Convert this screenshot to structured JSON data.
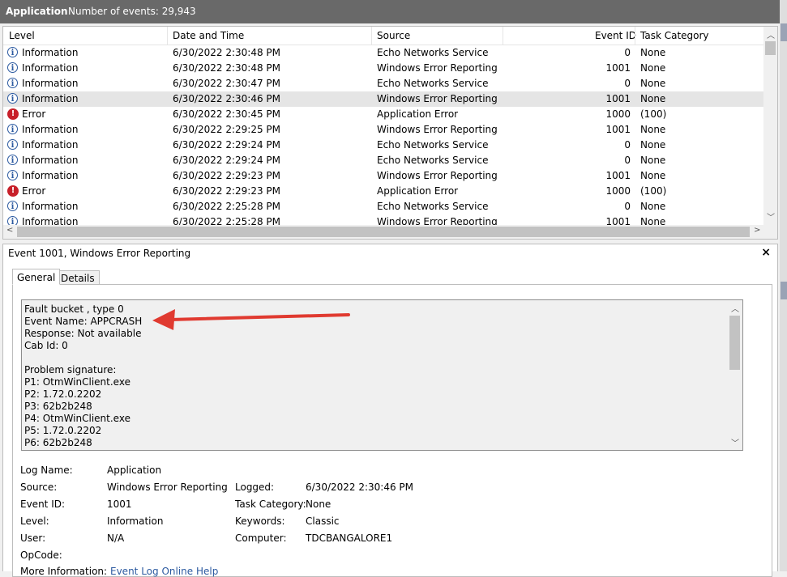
{
  "header": {
    "app": "Application",
    "count": "Number of events: 29,943"
  },
  "columns": {
    "level": "Level",
    "date": "Date and Time",
    "source": "Source",
    "event_id": "Event ID",
    "task": "Task Category"
  },
  "events": [
    {
      "level": "Information",
      "date": "6/30/2022 2:30:48 PM",
      "source": "Echo Networks Service",
      "id": "0",
      "task": "None",
      "type": "info"
    },
    {
      "level": "Information",
      "date": "6/30/2022 2:30:48 PM",
      "source": "Windows Error Reporting",
      "id": "1001",
      "task": "None",
      "type": "info"
    },
    {
      "level": "Information",
      "date": "6/30/2022 2:30:47 PM",
      "source": "Echo Networks Service",
      "id": "0",
      "task": "None",
      "type": "info"
    },
    {
      "level": "Information",
      "date": "6/30/2022 2:30:46 PM",
      "source": "Windows Error Reporting",
      "id": "1001",
      "task": "None",
      "type": "info",
      "selected": true
    },
    {
      "level": "Error",
      "date": "6/30/2022 2:30:45 PM",
      "source": "Application Error",
      "id": "1000",
      "task": "(100)",
      "type": "error"
    },
    {
      "level": "Information",
      "date": "6/30/2022 2:29:25 PM",
      "source": "Windows Error Reporting",
      "id": "1001",
      "task": "None",
      "type": "info"
    },
    {
      "level": "Information",
      "date": "6/30/2022 2:29:24 PM",
      "source": "Echo Networks Service",
      "id": "0",
      "task": "None",
      "type": "info"
    },
    {
      "level": "Information",
      "date": "6/30/2022 2:29:24 PM",
      "source": "Echo Networks Service",
      "id": "0",
      "task": "None",
      "type": "info"
    },
    {
      "level": "Information",
      "date": "6/30/2022 2:29:23 PM",
      "source": "Windows Error Reporting",
      "id": "1001",
      "task": "None",
      "type": "info"
    },
    {
      "level": "Error",
      "date": "6/30/2022 2:29:23 PM",
      "source": "Application Error",
      "id": "1000",
      "task": "(100)",
      "type": "error"
    },
    {
      "level": "Information",
      "date": "6/30/2022 2:25:28 PM",
      "source": "Echo Networks Service",
      "id": "0",
      "task": "None",
      "type": "info"
    },
    {
      "level": "Information",
      "date": "6/30/2022 2:25:28 PM",
      "source": "Windows Error Reporting",
      "id": "1001",
      "task": "None",
      "type": "info"
    }
  ],
  "detail": {
    "title": "Event 1001, Windows Error Reporting",
    "close": "×",
    "tabs": {
      "general": "General",
      "details": "Details"
    },
    "description": [
      "Fault bucket , type 0",
      "Event Name: APPCRASH",
      "Response: Not available",
      "Cab Id: 0",
      "",
      "Problem signature:",
      "P1: OtmWinClient.exe",
      "P2: 1.72.0.2202",
      "P3: 62b2b248",
      "P4: OtmWinClient.exe",
      "P5: 1.72.0.2202",
      "P6: 62b2b248"
    ],
    "fields": {
      "log_name_label": "Log Name:",
      "log_name": "Application",
      "source_label": "Source:",
      "source": "Windows Error Reporting",
      "logged_label": "Logged:",
      "logged": "6/30/2022 2:30:46 PM",
      "event_id_label": "Event ID:",
      "event_id": "1001",
      "task_label": "Task Category:",
      "task": "None",
      "level_label": "Level:",
      "level": "Information",
      "keywords_label": "Keywords:",
      "keywords": "Classic",
      "user_label": "User:",
      "user": "N/A",
      "computer_label": "Computer:",
      "computer": "TDCBANGALORE1",
      "opcode_label": "OpCode:",
      "more_label": "More Information:",
      "more_link": "Event Log Online Help"
    }
  },
  "colors": {
    "annotation_arrow": "#e03a30",
    "titlebar": "#696969",
    "selected_row": "#e5e5e5"
  }
}
